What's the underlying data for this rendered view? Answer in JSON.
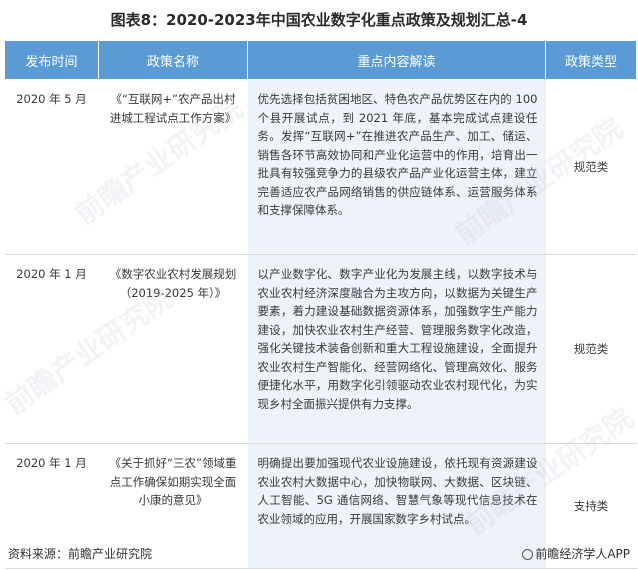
{
  "title": "图表8：2020-2023年中国农业数字化重点政策及规划汇总-4",
  "columns": [
    "发布时间",
    "政策名称",
    "重点内容解读",
    "政策类型"
  ],
  "rows": [
    {
      "date": "2020 年 5 月",
      "name": "《“互联网+”农产品出村进城工程试点工作方案》",
      "content": "优先选择包括贫困地区、特色农产品优势区在内的 100 个县开展试点，到 2021 年底，基本完成试点建设任务。发挥“互联网+”在推进农产品生产、加工、储运、销售各环节高效协同和产业化运营中的作用，培育出一批具有较强竞争力的县级农产品产业化运营主体，建立完善适应农产品网络销售的供应链体系、运营服务体系和支撑保障体系。",
      "type": "规范类"
    },
    {
      "date": "2020 年 1 月",
      "name": "《数字农业农村发展规划（2019-2025 年）》",
      "content": "以产业数字化、数字产业化为发展主线，以数字技术与农业农村经济深度融合为主攻方向，以数据为关键生产要素，着力建设基础数据资源体系，加强数字生产能力建设，加快农业农村生产经营、管理服务数字化改造，强化关键技术装备创新和重大工程设施建设，全面提升农业农村生产智能化、经营网络化、管理高效化、服务便捷化水平，用数字化引领驱动农业农村现代化，为实现乡村全面振兴提供有力支撑。",
      "type": "规范类"
    },
    {
      "date": "2020 年 1 月",
      "name": "《关于抓好“三农”领域重点工作确保如期实现全面小康的意见》",
      "content": "明确提出要加强现代农业设施建设，依托现有资源建设农业农村大数据中心，加快物联网、大数据、区块链、人工智能、5G 通信网络、智慧气象等现代信息技术在农业领域的应用，开展国家数字乡村试点。",
      "type": "支持类"
    }
  ],
  "footer": {
    "source": "资料来源：前瞻产业研究院",
    "brand": "前瞻经济学人APP"
  },
  "watermark": "前瞻产业研究院"
}
